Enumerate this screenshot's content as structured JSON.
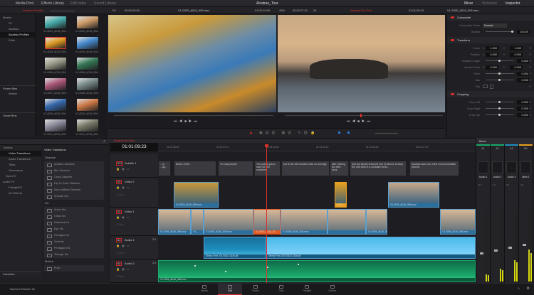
{
  "app": {
    "title": "Alcatraz_Tour",
    "version_label": "DaVinci Resolve 15"
  },
  "toolbar": {
    "media_pool": "Media Pool",
    "effects_library": "Effects Library",
    "edit_index": "Edit Index",
    "sound_library": "Sound Library",
    "mixer": "Mixer",
    "metadata": "Metadata",
    "inspector": "Inspector"
  },
  "source_viewer": {
    "bin": "Alcatraz Profiles",
    "fit": "Fit",
    "duration": "00:00:05:00",
    "clip": "V1-0003_A016_006.mov",
    "timecode": "01:00:10:00"
  },
  "program_viewer": {
    "zoom": "43%",
    "duration": "00:02:27:22",
    "fps": "24",
    "timeline": "Alcatraz Pro Res",
    "timecode": "01:01:09:23",
    "clip": "V1-0002_A016_006.mov"
  },
  "bins": {
    "tree": [
      "Master",
      "SF",
      "Alcatraz",
      "Alcatraz Profiles",
      "Edits"
    ],
    "selected": 3,
    "power_bins": "Power Bins",
    "power_master": "Master",
    "smart_bins": "Smart Bins"
  },
  "media": [
    {
      "name": "V1-0001_A016_006...",
      "color": "#4aa"
    },
    {
      "name": "V1-0002_A016_006...",
      "color": "#c96"
    },
    {
      "name": "V1-0003_A016_006...",
      "color": "#d92"
    },
    {
      "name": "V1-0004_A016_006...",
      "color": "#48c"
    },
    {
      "name": "V1-0005_A016_006...",
      "color": "#998"
    },
    {
      "name": "V1-0006_A016_006...",
      "color": "#375"
    },
    {
      "name": "V1-0007_A016_006...",
      "color": "#a57"
    },
    {
      "name": "V1-0008_A016_006...",
      "color": "#788"
    },
    {
      "name": "V1-0009_A016_006...",
      "color": "#36a"
    },
    {
      "name": "V1-0010_A016_006...",
      "color": "#c74"
    },
    {
      "name": "V1-0011_A016_006...",
      "color": "#889"
    },
    {
      "name": "V1-0012_A016_006...",
      "color": "#776"
    }
  ],
  "inspector": {
    "composite": {
      "title": "Composite",
      "mode_label": "Composite Mode",
      "mode": "Normal",
      "opacity_label": "Opacity",
      "opacity": "100.00"
    },
    "transform": {
      "title": "Transform",
      "rows": [
        {
          "label": "Zoom",
          "x": "1.000",
          "y": "1.000"
        },
        {
          "label": "Position",
          "x": "0.000",
          "y": "0.000"
        },
        {
          "label": "Rotation Angle",
          "v": "0.000"
        },
        {
          "label": "Anchor Point",
          "x": "0.000",
          "y": "0.000"
        },
        {
          "label": "Pitch",
          "v": "0.000"
        },
        {
          "label": "Yaw",
          "v": "0.000"
        },
        {
          "label": "Flip"
        }
      ]
    },
    "cropping": {
      "title": "Cropping",
      "rows": [
        {
          "label": "Crop Left",
          "v": "0.000"
        },
        {
          "label": "Crop Right",
          "v": "0.000"
        },
        {
          "label": "Crop Top",
          "v": "0.000"
        }
      ]
    }
  },
  "effects": {
    "tree": [
      "Toolbox",
      "Video Transitions",
      "Audio Transitions",
      "Titles",
      "Generators",
      "OpenFX",
      "Audio FX",
      "FairlightFX",
      "AU Effects"
    ],
    "selected": 1,
    "favorites": "Favorites",
    "title": "Video Transitions",
    "groups": [
      {
        "name": "Dissolve",
        "items": [
          "Additive Dissolve",
          "Blur Dissolve",
          "Cross Dissolve",
          "Dip To Color Dissolve",
          "Non-Additive Dissolve",
          "Smooth Cut"
        ]
      },
      {
        "name": "Iris",
        "items": [
          "Arrow Iris",
          "Cross Iris",
          "Diamond Iris",
          "Eye Iris",
          "Hexagon Iris",
          "Oval Iris",
          "Pentagon Iris",
          "Triangle Iris"
        ]
      },
      {
        "name": "Motion",
        "items": [
          "Push"
        ]
      }
    ]
  },
  "timeline": {
    "tab": "Alcatraz Pro Res",
    "timecode": "01:01:09:23",
    "ruler": [
      "01:01:05:00",
      "01:01:07:12",
      "01:01:10:00",
      "01:01:12:12",
      "01:01:15:00",
      "01:01:17:12"
    ],
    "tracks": [
      {
        "id": "ST1",
        "name": "Subtitle 1",
        "count": ""
      },
      {
        "id": "V2",
        "name": "Video 2",
        "count": "3 Clips"
      },
      {
        "id": "V1",
        "name": "Video 1",
        "count": "8 Clips"
      },
      {
        "id": "A1",
        "name": "Audio 1",
        "level": "2.0",
        "count": "2 Clips"
      },
      {
        "id": "A2",
        "name": "Audio 2",
        "level": "2.0",
        "count": "2 Clips"
      }
    ],
    "subtitles": [
      "...ry ...ag...",
      "Built in 1934",
      "To most people",
      "The past is just a story we tell ourselves",
      "but to the 250 inmates held on average",
      "with nothing but their wool,",
      "and the strictly enforced rule of silence to keep the 336 cells in a constant remin...",
      "Alcatraz was one of the most formidable prisons"
    ],
    "v2_clips": [
      "V1-0003_A016_006.mov",
      "V1-0...",
      "V1-0002_A016_006.mov"
    ],
    "v1_clips": [
      "V1-0006_A016_006.mov",
      "V1-...",
      "V1-0002_A016_006.mov",
      "V1-0002_A016_00...",
      "V1-0005_A016_006.mov",
      "",
      "V1-0004_A016_006.mov",
      "V1-0006_A016_006.mov"
    ],
    "a1_clips": [
      "Stress Free 20170810 1346.aif",
      "Stress Free 20170810 1346.aif"
    ],
    "a2_clip": "V1-0006_A016_006.mov"
  },
  "mixer": {
    "title": "Mixer",
    "channels": [
      {
        "bus": "A1",
        "name": "Audio 1",
        "db": "-0.7",
        "level": 0.1
      },
      {
        "bus": "A2",
        "name": "Audio 2",
        "db": "-1.0",
        "level": 0.18
      },
      {
        "bus": "A3",
        "name": "Audio 3",
        "db": "0.0",
        "level": 0.3
      },
      {
        "bus": "M1",
        "name": "Main 1",
        "db": "0.0",
        "level": 0.45
      }
    ]
  },
  "pages": [
    "Media",
    "Edit",
    "Fusion",
    "Color",
    "Fairlight",
    "Deliver"
  ],
  "active_page": 1,
  "colors": {
    "accent": "#e0302a",
    "video_clip": "#2b6f9c",
    "audio1": "#1e8fbf",
    "audio2": "#1aa86a"
  }
}
